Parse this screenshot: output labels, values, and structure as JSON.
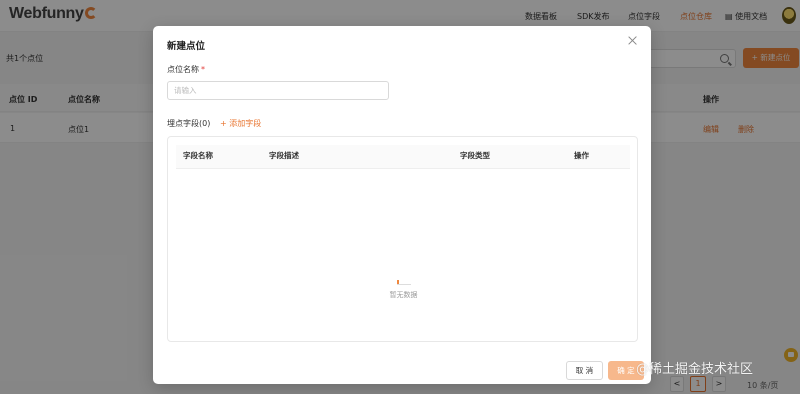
{
  "app": {
    "logo": "Webfunny",
    "nav": [
      "数据看板",
      "SDK发布",
      "点位字段",
      "点位仓库",
      "使用文档"
    ],
    "active_nav": "点位仓库"
  },
  "toolbar": {
    "count_text": "共1个点位",
    "new_button": "+ 新建点位"
  },
  "table": {
    "headers": [
      "点位 ID",
      "点位名称",
      "操作"
    ],
    "rows": [
      {
        "id": "1",
        "name": "点位1",
        "edit": "编辑",
        "delete": "删除"
      }
    ]
  },
  "pagination": {
    "prev": "<",
    "current_page": "1",
    "next": ">",
    "page_size": "10 条/页"
  },
  "modal": {
    "title": "新建点位",
    "name_label": "点位名称",
    "required_mark": "*",
    "name_placeholder": "请输入",
    "fields_label": "埋点字段(0)",
    "add_field_link": "+ 添加字段",
    "field_columns": [
      "字段名称",
      "字段描述",
      "字段类型",
      "操作"
    ],
    "empty_text": "暂无数据",
    "cancel_button": "取 消",
    "confirm_button": "确 定"
  },
  "watermark": "@稀土掘金技术社区",
  "colors": {
    "accent": "#e8742f",
    "primary_button": "#f0883e",
    "confirm_disabled": "#f7b88c",
    "required": "#e23c39"
  }
}
